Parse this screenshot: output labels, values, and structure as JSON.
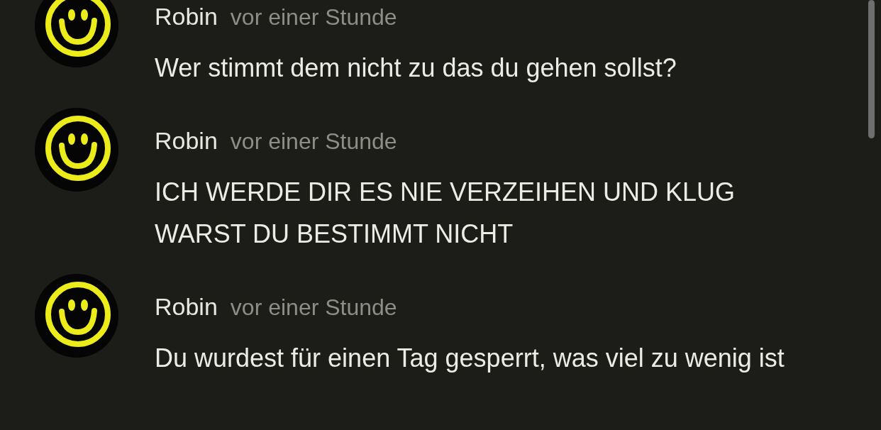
{
  "comments": [
    {
      "author": "Robin",
      "time": "vor einer Stunde",
      "text": "Wer stimmt dem nicht zu das du gehen sollst?"
    },
    {
      "author": "Robin",
      "time": "vor einer Stunde",
      "text": "ICH WERDE DIR ES NIE VERZEIHEN UND KLUG WARST DU BESTIMMT NICHT"
    },
    {
      "author": "Robin",
      "time": "vor einer Stunde",
      "text": "Du wurdest für einen Tag gesperrt, was viel zu wenig ist"
    }
  ]
}
